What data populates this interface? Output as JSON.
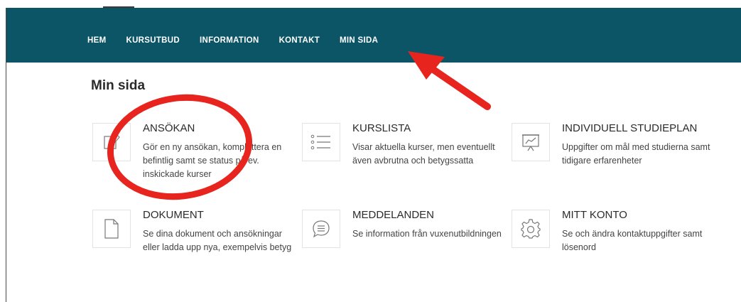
{
  "nav": {
    "items": [
      "HEM",
      "KURSUTBUD",
      "INFORMATION",
      "KONTAKT",
      "MIN SIDA"
    ]
  },
  "page": {
    "title": "Min sida"
  },
  "cards": [
    {
      "title": "ANSÖKAN",
      "desc": "Gör en ny ansökan, komplettera en befintlig samt se status på ev. inskickade kurser",
      "icon": "edit-icon"
    },
    {
      "title": "KURSLISTA",
      "desc": "Visar aktuella kurser, men eventuellt även avbrutna och betygssatta",
      "icon": "list-icon"
    },
    {
      "title": "INDIVIDUELL STUDIEPLAN",
      "desc": "Uppgifter om mål med studierna samt tidigare erfarenheter",
      "icon": "chart-presentation-icon"
    },
    {
      "title": "DOKUMENT",
      "desc": "Se dina dokument och ansökningar eller ladda upp nya, exempelvis betyg",
      "icon": "document-icon"
    },
    {
      "title": "MEDDELANDEN",
      "desc": "Se information från vuxenutbildningen",
      "icon": "message-icon"
    },
    {
      "title": "MITT KONTO",
      "desc": "Se och ändra kontaktuppgifter samt lösenord",
      "icon": "gear-icon"
    }
  ],
  "colors": {
    "header": "#0b5566",
    "annotation": "#e8241e"
  }
}
